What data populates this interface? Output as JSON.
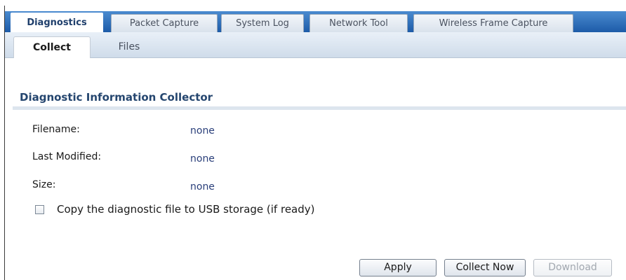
{
  "tabs": [
    {
      "label": "Diagnostics",
      "active": true
    },
    {
      "label": "Packet Capture",
      "active": false
    },
    {
      "label": "System Log",
      "active": false
    },
    {
      "label": "Network Tool",
      "active": false
    },
    {
      "label": "Wireless Frame Capture",
      "active": false
    }
  ],
  "subtabs": [
    {
      "label": "Collect",
      "active": true
    },
    {
      "label": "Files",
      "active": false
    }
  ],
  "section": {
    "title": "Diagnostic Information Collector"
  },
  "fields": {
    "filename": {
      "label": "Filename:",
      "value": "none"
    },
    "last_modified": {
      "label": "Last Modified:",
      "value": "none"
    },
    "size": {
      "label": "Size:",
      "value": "none"
    }
  },
  "copy_usb": {
    "label": "Copy the diagnostic file to USB storage (if ready)",
    "checked": false
  },
  "buttons": {
    "apply": "Apply",
    "collect_now": "Collect Now",
    "download": "Download"
  },
  "colors": {
    "tabbar_top": "#4a8bd0",
    "tabbar_bottom": "#1d5ba8",
    "section_title": "#25466f",
    "value_text": "#2a3f7a"
  }
}
